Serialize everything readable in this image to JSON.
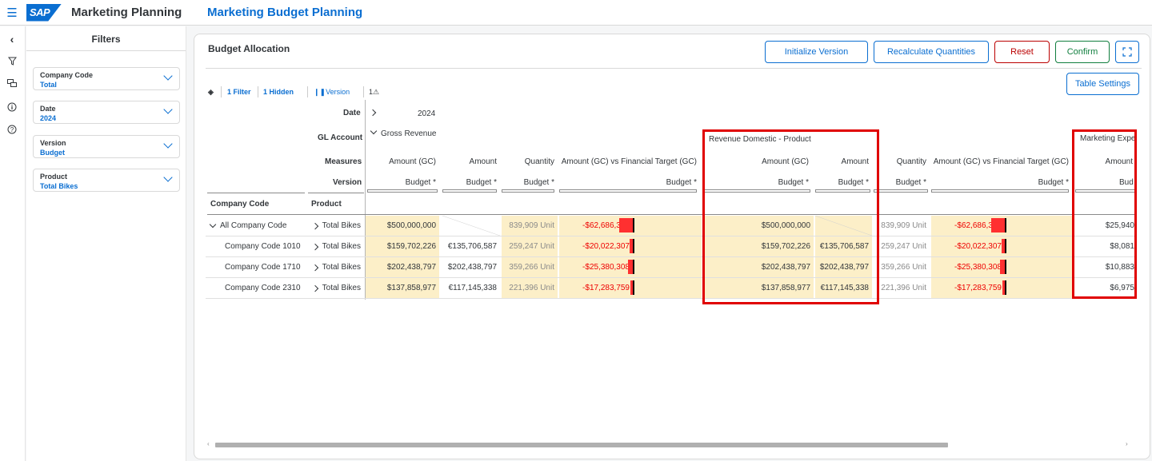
{
  "shell": {
    "logo": "SAP",
    "app_title": "Marketing Planning",
    "page_title": "Marketing Budget Planning"
  },
  "filters": {
    "title": "Filters",
    "items": [
      {
        "label": "Company Code",
        "value": "Total"
      },
      {
        "label": "Date",
        "value": "2024"
      },
      {
        "label": "Version",
        "value": "Budget"
      },
      {
        "label": "Product",
        "value": "Total Bikes"
      }
    ]
  },
  "card": {
    "title": "Budget Allocation",
    "buttons": {
      "init": "Initialize Version",
      "recalc": "Recalculate Quantities",
      "reset": "Reset",
      "confirm": "Confirm",
      "table_settings": "Table Settings"
    },
    "toolbar": {
      "filter": "1 Filter",
      "hidden": "1 Hidden",
      "version": "Version",
      "warnings": "1"
    }
  },
  "grid": {
    "row_headers": {
      "date": "Date",
      "gl_account": "GL Account",
      "measures": "Measures",
      "version": "Version",
      "company_code": "Company Code",
      "product": "Product"
    },
    "date_value": "2024",
    "gl_value": "Gross Revenue",
    "group2_title": "Revenue Domestic - Product",
    "group3_title": "Marketing Expe",
    "measures": [
      "Amount (GC)",
      "Amount",
      "Quantity",
      "Amount (GC) vs Financial Target (GC)",
      "Amount (GC)",
      "Amount",
      "Quantity",
      "Amount (GC) vs Financial Target (GC)",
      "Amount"
    ],
    "versions": [
      "Budget *",
      "Budget *",
      "Budget *",
      "Budget *",
      "Budget *",
      "Budget *",
      "Budget *",
      "Budget *",
      "Bud"
    ],
    "rows": [
      {
        "company": "All Company Code",
        "product": "Total Bikes",
        "amt_gc": "$500,000,000",
        "amt": "",
        "qty": "839,909 Unit",
        "vs": "-$62,686,374",
        "vs_fraction": 0.8,
        "amt_gc2": "$500,000,000",
        "amt2": "",
        "qty2": "839,909 Unit",
        "vs2": "-$62,686,374",
        "m3": "$25,940"
      },
      {
        "company": "Company Code 1010",
        "product": "Total Bikes",
        "amt_gc": "$159,702,226",
        "amt": "€135,706,587",
        "qty": "259,247 Unit",
        "vs": "-$20,022,307",
        "vs_fraction": 0.25,
        "amt_gc2": "$159,702,226",
        "amt2": "€135,706,587",
        "qty2": "259,247 Unit",
        "vs2": "-$20,022,307",
        "m3": "$8,081"
      },
      {
        "company": "Company Code 1710",
        "product": "Total Bikes",
        "amt_gc": "$202,438,797",
        "amt": "$202,438,797",
        "qty": "359,266 Unit",
        "vs": "-$25,380,308",
        "vs_fraction": 0.33,
        "amt_gc2": "$202,438,797",
        "amt2": "$202,438,797",
        "qty2": "359,266 Unit",
        "vs2": "-$25,380,308",
        "m3": "$10,883"
      },
      {
        "company": "Company Code 2310",
        "product": "Total Bikes",
        "amt_gc": "$137,858,977",
        "amt": "€117,145,338",
        "qty": "221,396 Unit",
        "vs": "-$17,283,759",
        "vs_fraction": 0.22,
        "amt_gc2": "$137,858,977",
        "amt2": "€117,145,338",
        "qty2": "221,396 Unit",
        "vs2": "-$17,283,759",
        "m3": "$6,975"
      }
    ]
  }
}
